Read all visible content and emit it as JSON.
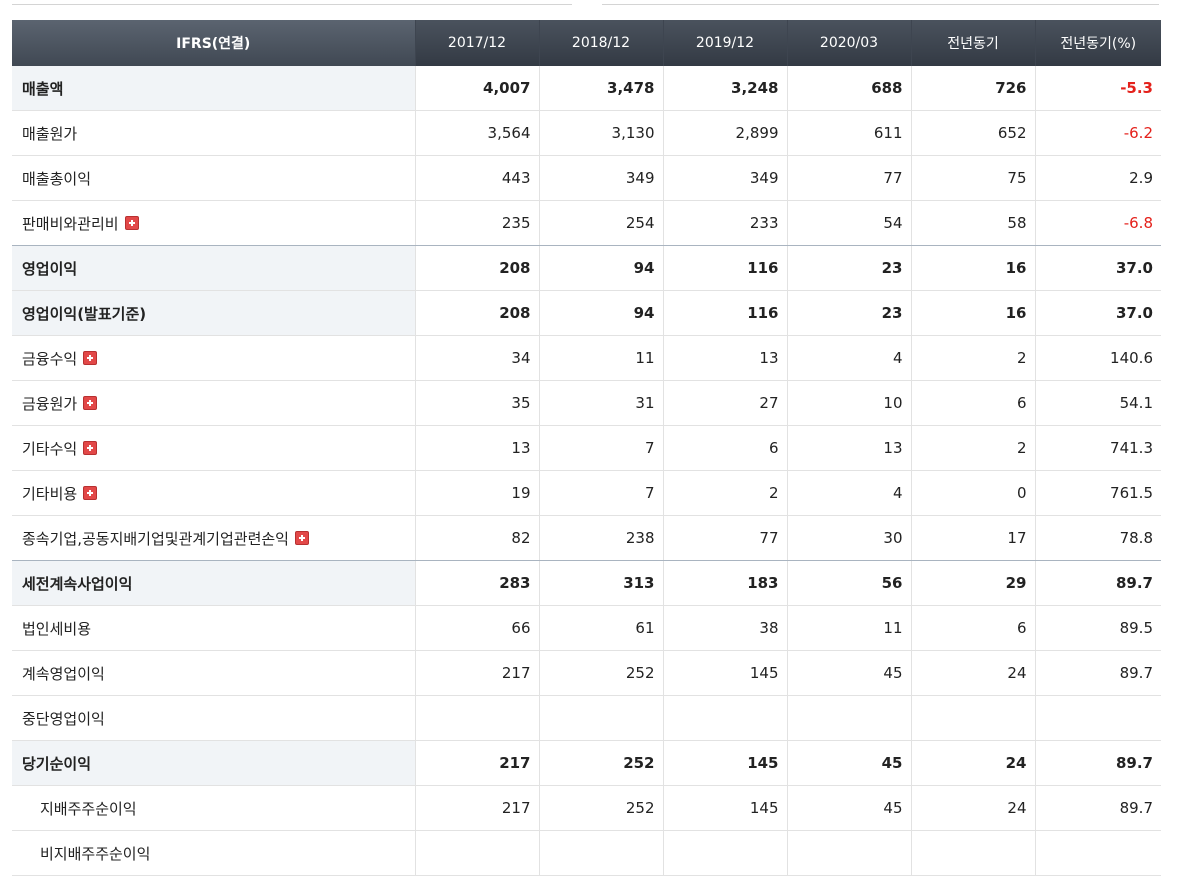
{
  "table": {
    "headers": [
      "IFRS(연결)",
      "2017/12",
      "2018/12",
      "2019/12",
      "2020/03",
      "전년동기",
      "전년동기(%)"
    ],
    "rows": [
      {
        "label": "매출액",
        "bold": true,
        "expand": false,
        "values": [
          "4,007",
          "3,478",
          "3,248",
          "688",
          "726",
          "-5.3"
        ]
      },
      {
        "label": "매출원가",
        "bold": false,
        "expand": false,
        "values": [
          "3,564",
          "3,130",
          "2,899",
          "611",
          "652",
          "-6.2"
        ]
      },
      {
        "label": "매출총이익",
        "bold": false,
        "expand": false,
        "values": [
          "443",
          "349",
          "349",
          "77",
          "75",
          "2.9"
        ]
      },
      {
        "label": "판매비와관리비",
        "bold": false,
        "expand": true,
        "values": [
          "235",
          "254",
          "233",
          "54",
          "58",
          "-6.8"
        ]
      },
      {
        "label": "영업이익",
        "bold": true,
        "expand": false,
        "values": [
          "208",
          "94",
          "116",
          "23",
          "16",
          "37.0"
        ]
      },
      {
        "label": "영업이익(발표기준)",
        "bold": true,
        "expand": false,
        "values": [
          "208",
          "94",
          "116",
          "23",
          "16",
          "37.0"
        ]
      },
      {
        "label": "금융수익",
        "bold": false,
        "expand": true,
        "values": [
          "34",
          "11",
          "13",
          "4",
          "2",
          "140.6"
        ]
      },
      {
        "label": "금융원가",
        "bold": false,
        "expand": true,
        "values": [
          "35",
          "31",
          "27",
          "10",
          "6",
          "54.1"
        ]
      },
      {
        "label": "기타수익",
        "bold": false,
        "expand": true,
        "values": [
          "13",
          "7",
          "6",
          "13",
          "2",
          "741.3"
        ]
      },
      {
        "label": "기타비용",
        "bold": false,
        "expand": true,
        "values": [
          "19",
          "7",
          "2",
          "4",
          "0",
          "761.5"
        ]
      },
      {
        "label": "종속기업,공동지배기업및관계기업관련손익",
        "bold": false,
        "expand": true,
        "values": [
          "82",
          "238",
          "77",
          "30",
          "17",
          "78.8"
        ]
      },
      {
        "label": "세전계속사업이익",
        "bold": true,
        "expand": false,
        "values": [
          "283",
          "313",
          "183",
          "56",
          "29",
          "89.7"
        ]
      },
      {
        "label": "법인세비용",
        "bold": false,
        "expand": false,
        "values": [
          "66",
          "61",
          "38",
          "11",
          "6",
          "89.5"
        ]
      },
      {
        "label": "계속영업이익",
        "bold": false,
        "expand": false,
        "values": [
          "217",
          "252",
          "145",
          "45",
          "24",
          "89.7"
        ]
      },
      {
        "label": "중단영업이익",
        "bold": false,
        "expand": false,
        "values": [
          "",
          "",
          "",
          "",
          "",
          ""
        ]
      },
      {
        "label": "당기순이익",
        "bold": true,
        "expand": false,
        "values": [
          "217",
          "252",
          "145",
          "45",
          "24",
          "89.7"
        ]
      },
      {
        "label": "지배주주순이익",
        "bold": false,
        "expand": false,
        "sub": true,
        "values": [
          "217",
          "252",
          "145",
          "45",
          "24",
          "89.7"
        ]
      },
      {
        "label": "비지배주주순이익",
        "bold": false,
        "expand": false,
        "sub": true,
        "values": [
          "",
          "",
          "",
          "",
          "",
          ""
        ]
      }
    ]
  },
  "colors": {
    "header_bg": "#3a414b",
    "negative": "#e4211b",
    "bold_label_bg": "#f1f4f7",
    "expand_icon": "#e24848"
  },
  "icons": {
    "expand": "plus-expand-icon"
  }
}
